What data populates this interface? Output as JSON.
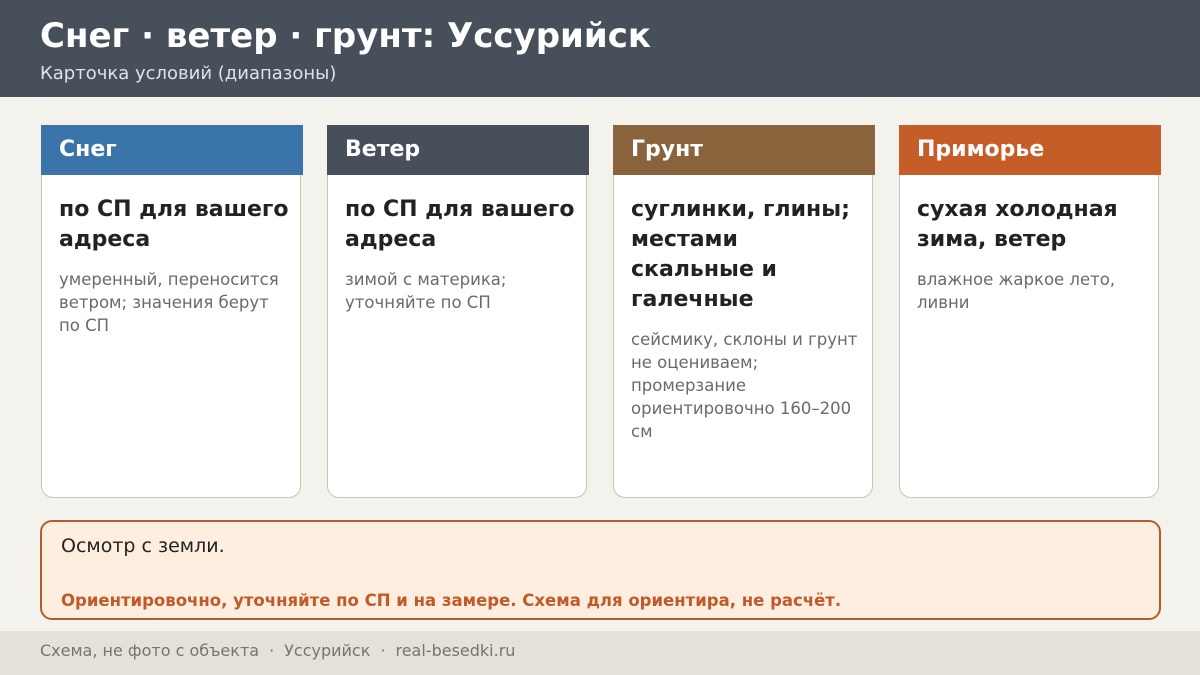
{
  "header": {
    "title": "Снег · ветер · грунт: Уссурийск",
    "subtitle": "Карточка условий (диапазоны)"
  },
  "cards": [
    {
      "heading": "Снег",
      "main": "по СП для вашего адреса",
      "note": "умеренный, переносится ветром; значения берут по СП",
      "color": "#3b74a8"
    },
    {
      "heading": "Ветер",
      "main": "по СП для вашего адреса",
      "note": "зимой с материка; уточняйте по СП",
      "color": "#474f5b"
    },
    {
      "heading": "Грунт",
      "main": "суглинки, глины; местами скальные и галечные",
      "note": "сейсмику, склоны и грунт не оцениваем; промерзание ориентировочно 160–200 см",
      "color": "#8a633d"
    },
    {
      "heading": "Приморье",
      "main": "сухая холодная зима, ветер",
      "note": "влажное жаркое лето, ливни",
      "color": "#c55d28"
    }
  ],
  "notice": {
    "text": "Осмотр с земли.",
    "warning": "Ориентировочно, уточняйте по СП и на замере. Схема для ориентира, не расчёт."
  },
  "footer": {
    "items": [
      "Схема, не фото с объекта",
      "Уссурийск",
      "real-besedki.ru"
    ],
    "separator": "·"
  }
}
